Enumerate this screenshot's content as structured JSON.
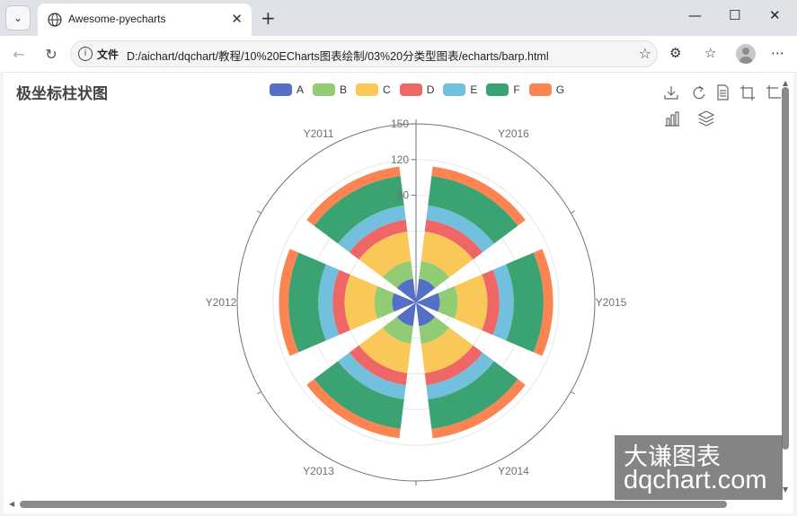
{
  "browser": {
    "tab_title": "Awesome-pyecharts",
    "address_label": "文件",
    "url": "D:/aichart/dqchart/教程/10%20ECharts图表绘制/03%20分类型图表/echarts/barp.html",
    "icons": [
      "tab-list-icon",
      "globe-icon",
      "close-icon",
      "new-tab-icon",
      "minimize-icon",
      "maximize-icon",
      "window-close-icon",
      "back-icon",
      "refresh-icon",
      "info-icon",
      "favorite-star-icon",
      "extensions-icon",
      "favorites-icon",
      "profile-icon",
      "more-icon"
    ]
  },
  "page": {
    "title": "极坐标柱状图",
    "toolbox_icons": [
      "save-image-icon",
      "restore-icon",
      "data-view-icon",
      "zoom-icon",
      "zoom-back-icon",
      "bar-switch-icon",
      "stack-switch-icon"
    ]
  },
  "chart_data": {
    "type": "bar",
    "coordinate": "polar",
    "stacked": true,
    "title": "极坐标柱状图",
    "categories": [
      "Y2011",
      "Y2012",
      "Y2013",
      "Y2014",
      "Y2015",
      "Y2016"
    ],
    "radius_ticks": [
      150,
      120,
      90
    ],
    "radius_max": 150,
    "legend_position": "top",
    "series": [
      {
        "name": "A",
        "color": "#5470c6",
        "values": [
          20,
          20,
          20,
          20,
          20,
          20
        ]
      },
      {
        "name": "B",
        "color": "#91cc75",
        "values": [
          15,
          15,
          15,
          15,
          15,
          15
        ]
      },
      {
        "name": "C",
        "color": "#fac858",
        "values": [
          25,
          25,
          25,
          25,
          25,
          25
        ]
      },
      {
        "name": "D",
        "color": "#ee6666",
        "values": [
          10,
          10,
          10,
          10,
          10,
          10
        ]
      },
      {
        "name": "E",
        "color": "#73c0de",
        "values": [
          12,
          12,
          12,
          12,
          12,
          12
        ]
      },
      {
        "name": "F",
        "color": "#3ba272",
        "values": [
          25,
          25,
          25,
          25,
          25,
          25
        ]
      },
      {
        "name": "G",
        "color": "#fc8452",
        "values": [
          8,
          8,
          8,
          8,
          8,
          8
        ]
      }
    ]
  },
  "watermark": {
    "line1": "大谦图表",
    "line2": "dqchart.com"
  }
}
